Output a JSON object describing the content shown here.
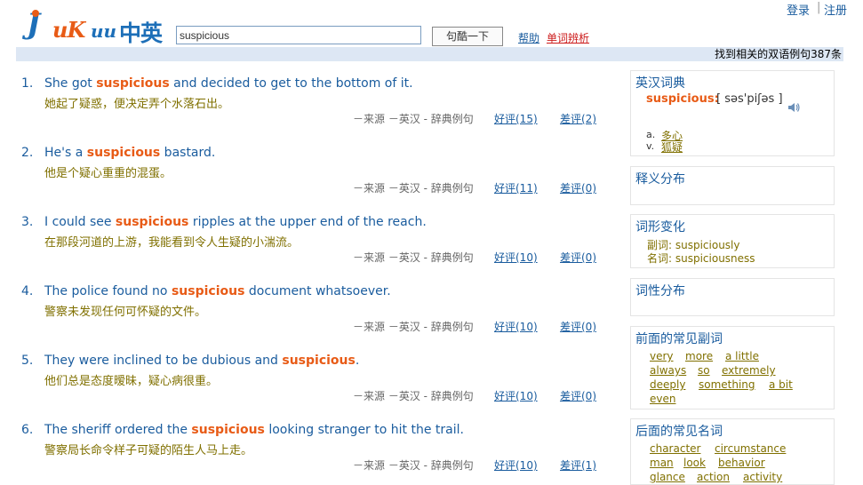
{
  "header": {
    "logo_alt": "JuKuu中英",
    "search_value": "suspicious",
    "search_button": "句酷一下",
    "help_link": "帮助",
    "analysis_link": "单词辨析",
    "login_link": "登录",
    "separator": "|",
    "register_link": "注册",
    "result_count": "找到相关的双语例句387条"
  },
  "results": [
    {
      "num": "1.",
      "pre": "She got ",
      "kw": "suspicious",
      "post": " and decided to get to the bottom of it.",
      "zh": "她起了疑惑，便决定弄个水落石出。",
      "source": "－来源 －英汉 - 辞典例句",
      "good": "好评(15)",
      "bad": "差评(2)"
    },
    {
      "num": "2.",
      "pre": "He's a ",
      "kw": "suspicious",
      "post": " bastard.",
      "zh": "他是个疑心重重的混蛋。",
      "source": "－来源 －英汉 - 辞典例句",
      "good": "好评(11)",
      "bad": "差评(0)"
    },
    {
      "num": "3.",
      "pre": "I could see ",
      "kw": "suspicious",
      "post": " ripples at the upper end of the reach.",
      "zh": "在那段河道的上游，我能看到令人生疑的小湍流。",
      "source": "－来源 －英汉 - 辞典例句",
      "good": "好评(10)",
      "bad": "差评(0)"
    },
    {
      "num": "4.",
      "pre": "The police found no ",
      "kw": "suspicious",
      "post": " document whatsoever.",
      "zh": "警察未发现任何可怀疑的文件。",
      "source": "－来源 －英汉 - 辞典例句",
      "good": "好评(10)",
      "bad": "差评(0)"
    },
    {
      "num": "5.",
      "pre": "They were inclined to be dubious and ",
      "kw": "suspicious",
      "post": ".",
      "zh": "他们总是态度暧昧，疑心病很重。",
      "source": "－来源 －英汉 - 辞典例句",
      "good": "好评(10)",
      "bad": "差评(0)"
    },
    {
      "num": "6.",
      "pre": "The sheriff ordered the ",
      "kw": "suspicious",
      "post": " looking stranger to hit the trail.",
      "zh": "警察局长命令样子可疑的陌生人马上走。",
      "source": "－来源 －英汉 - 辞典例句",
      "good": "好评(10)",
      "bad": "差评(1)"
    }
  ],
  "sidebar": {
    "dict": {
      "title": "英汉词典",
      "word": "suspicious:",
      "phonetic": "[ səs'piʃəs ]",
      "speaker_icon": "speaker-icon",
      "senses": [
        {
          "pos": "a.",
          "def": "多心"
        },
        {
          "pos": "v.",
          "def": "狐疑"
        }
      ]
    },
    "meaning_dist": {
      "title": "释义分布"
    },
    "forms": {
      "title": "词形变化",
      "items": [
        "副词: suspiciously",
        "名词: suspiciousness"
      ]
    },
    "pos_dist": {
      "title": "词性分布"
    },
    "adverbs": {
      "title": "前面的常见副词",
      "rows": [
        [
          "very",
          "more",
          "a little"
        ],
        [
          "always",
          "so",
          "extremely"
        ],
        [
          "deeply",
          "something",
          "a bit"
        ],
        [
          "even"
        ]
      ]
    },
    "nouns": {
      "title": "后面的常见名词",
      "rows": [
        [
          "character",
          "circumstance"
        ],
        [
          "man",
          "look",
          "behavior"
        ],
        [
          "glance",
          "action",
          "activity"
        ]
      ]
    }
  }
}
